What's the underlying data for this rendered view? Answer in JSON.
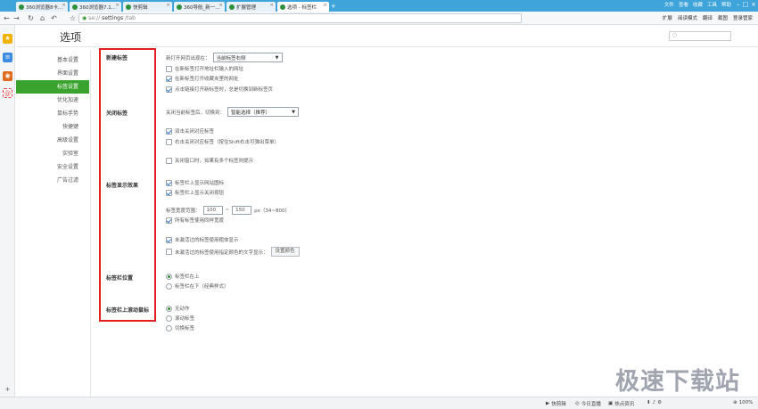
{
  "browser": {
    "tabs": [
      {
        "label": "360浏览器8卡..."
      },
      {
        "label": "360浏览器7.1..."
      },
      {
        "label": "快剪辑"
      },
      {
        "label": "360导航_新一..."
      },
      {
        "label": "扩展管理"
      },
      {
        "label": "选项 - 标签栏"
      }
    ],
    "new_tab": "+",
    "window_menu": [
      "文件",
      "查看",
      "收藏",
      "工具",
      "帮助"
    ],
    "address": {
      "scheme": "se://",
      "host": "settings",
      "path": "/tab"
    },
    "toolbar_right": [
      "扩展",
      "阅读模式",
      "翻译",
      "截图",
      "登录管家"
    ],
    "colors": {
      "tabbar": "#3fa4d9",
      "accent": "#3aa32e",
      "highlight": "#e21e1e"
    }
  },
  "page": {
    "title": "选项",
    "search_placeholder": "",
    "nav": [
      {
        "label": "基本设置"
      },
      {
        "label": "界面设置"
      },
      {
        "label": "标签设置",
        "active": true
      },
      {
        "label": "优化加速"
      },
      {
        "label": "鼠标手势"
      },
      {
        "label": "快捷键"
      },
      {
        "label": "高级设置"
      },
      {
        "label": "实验室"
      },
      {
        "label": "安全设置"
      },
      {
        "label": "广告过滤"
      }
    ]
  },
  "sections": {
    "new_tab": {
      "title": "新建标签",
      "open_pos_label": "新打开网页出现在：",
      "open_pos_value": "当前标签右侧",
      "opts": [
        {
          "label": "在新标签打开地址栏输入的网址",
          "checked": false
        },
        {
          "label": "在新标签打开收藏夹里的网址",
          "checked": true
        },
        {
          "label": "点击链接打开新标签时，总是切换到新标签页",
          "checked": true
        }
      ]
    },
    "close_tab": {
      "title": "关闭标签",
      "switch_label": "关闭当前标签后，切换到：",
      "switch_value": "智能选择（推荐）",
      "opts": [
        {
          "label": "双击关闭对应标签",
          "checked": true
        },
        {
          "label": "右击关闭对应标签（按住Shift右击可弹出菜单）",
          "checked": false
        },
        {
          "label": "关闭窗口时，如果有多个标签则提示",
          "checked": false
        }
      ]
    },
    "display": {
      "title": "标签显示效果",
      "opts": [
        {
          "label": "标签栏上显示网站图标",
          "checked": true
        },
        {
          "label": "标签栏上显示关闭按钮",
          "checked": true
        }
      ],
      "width_label": "标签宽度范围：",
      "width_min": "100",
      "width_sep": "~",
      "width_max": "150",
      "width_unit": "px（34~800）",
      "same_width": {
        "label": "所有标签使用同样宽度",
        "checked": true
      },
      "unvisited_bold": {
        "label": "未激活过的标签使用粗体显示",
        "checked": true
      },
      "unvisited_color": {
        "label": "未激活过的标签使用指定颜色的文字显示：",
        "checked": false
      },
      "set_color_btn": "设置颜色"
    },
    "position": {
      "title": "标签栏位置",
      "opts": [
        {
          "label": "标签栏在上",
          "selected": true
        },
        {
          "label": "标签栏在下（经典样式）",
          "selected": false
        }
      ]
    },
    "scroll": {
      "title": "标签栏上滚动鼠标",
      "opts": [
        {
          "label": "无动作",
          "selected": true
        },
        {
          "label": "滚动标签",
          "selected": false
        },
        {
          "label": "切换标签",
          "selected": false
        }
      ]
    }
  },
  "statusbar": {
    "items": [
      "快剪辑",
      "今日直播",
      "热点资讯"
    ],
    "zoom": "100%"
  },
  "watermark": "极速下载站"
}
